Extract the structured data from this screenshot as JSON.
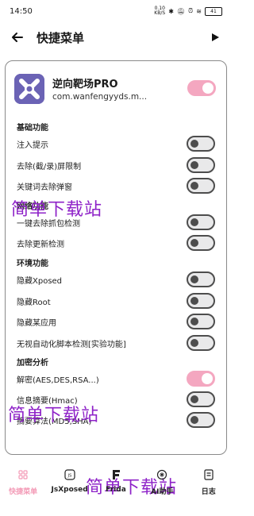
{
  "status_bar": {
    "time": "14:50",
    "net_speed_value": "0.10",
    "net_speed_unit": "KB/S",
    "battery": "41"
  },
  "header": {
    "title": "快捷菜单"
  },
  "app": {
    "name": "逆向靶场PRO",
    "package": "com.wanfengyyds.m...",
    "enabled": true,
    "icon_color": "#6b63b5"
  },
  "sections": [
    {
      "title": "基础功能",
      "items": [
        {
          "label": "注入提示",
          "enabled": false
        },
        {
          "label": "去除(截/录)屏限制",
          "enabled": false
        },
        {
          "label": "关键词去除弹窗",
          "enabled": false
        }
      ]
    },
    {
      "title": "网络功能",
      "items": [
        {
          "label": "一键去除抓包检测",
          "enabled": false
        },
        {
          "label": "去除更新检测",
          "enabled": false
        }
      ]
    },
    {
      "title": "环境功能",
      "items": [
        {
          "label": "隐藏Xposed",
          "enabled": false
        },
        {
          "label": "隐藏Root",
          "enabled": false
        },
        {
          "label": "隐藏某应用",
          "enabled": false
        },
        {
          "label": "无视自动化脚本检测[实验功能]",
          "enabled": false
        }
      ]
    },
    {
      "title": "加密分析",
      "items": [
        {
          "label": "解密(AES,DES,RSA...)",
          "enabled": true
        },
        {
          "label": "信息摘要(Hmac)",
          "enabled": false
        },
        {
          "label": "摘要算法(MD5,SHA)",
          "enabled": false
        }
      ]
    }
  ],
  "watermark": "简单下载站",
  "bottom_nav": [
    {
      "label": "快捷菜单",
      "icon": "grid-icon",
      "active": true
    },
    {
      "label": "JsXposed",
      "icon": "js-icon",
      "active": false
    },
    {
      "label": "Frida",
      "icon": "frida-icon",
      "active": false
    },
    {
      "label": "AI助手",
      "icon": "ai-icon",
      "active": false
    },
    {
      "label": "日志",
      "icon": "log-icon",
      "active": false
    }
  ],
  "colors": {
    "accent": "#f4a7c0",
    "toggle_off_border": "#4d4d4d",
    "watermark": "#8e22c8"
  }
}
